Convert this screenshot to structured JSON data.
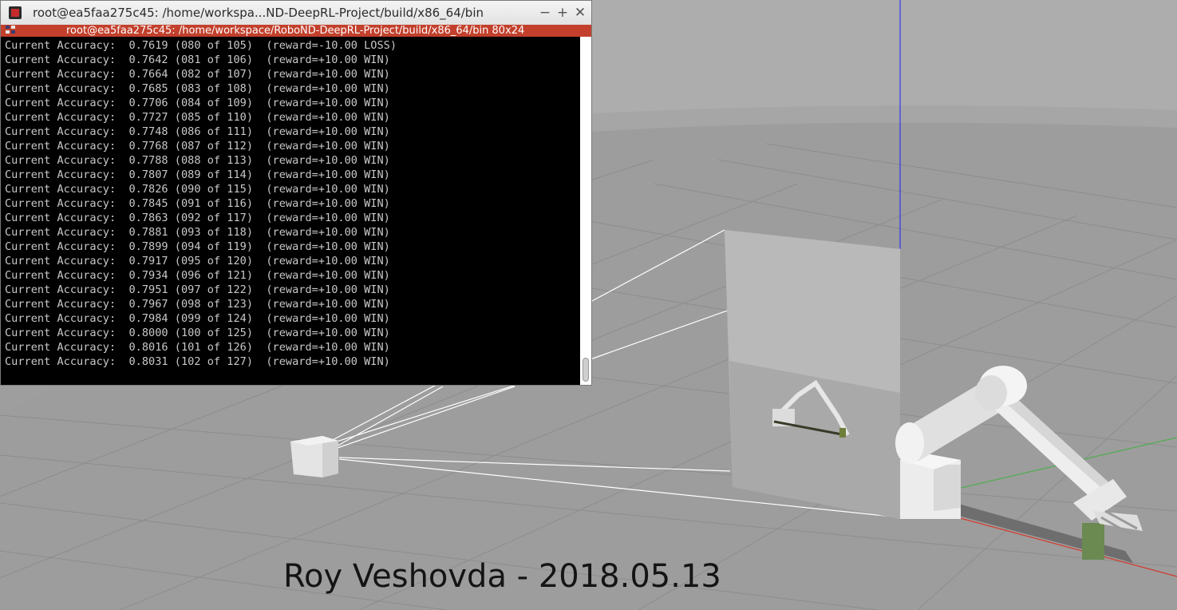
{
  "terminal": {
    "title": "root@ea5faa275c45: /home/workspa...ND-DeepRL-Project/build/x86_64/bin",
    "tab_label": "root@ea5faa275c45: /home/workspace/RoboND-DeepRL-Project/build/x86_64/bin 80x24",
    "minimize_glyph": "−",
    "maximize_glyph": "+",
    "close_glyph": "✕",
    "lines": [
      "Current Accuracy:  0.7619 (080 of 105)  (reward=-10.00 LOSS)",
      "Current Accuracy:  0.7642 (081 of 106)  (reward=+10.00 WIN)",
      "Current Accuracy:  0.7664 (082 of 107)  (reward=+10.00 WIN)",
      "Current Accuracy:  0.7685 (083 of 108)  (reward=+10.00 WIN)",
      "Current Accuracy:  0.7706 (084 of 109)  (reward=+10.00 WIN)",
      "Current Accuracy:  0.7727 (085 of 110)  (reward=+10.00 WIN)",
      "Current Accuracy:  0.7748 (086 of 111)  (reward=+10.00 WIN)",
      "Current Accuracy:  0.7768 (087 of 112)  (reward=+10.00 WIN)",
      "Current Accuracy:  0.7788 (088 of 113)  (reward=+10.00 WIN)",
      "Current Accuracy:  0.7807 (089 of 114)  (reward=+10.00 WIN)",
      "Current Accuracy:  0.7826 (090 of 115)  (reward=+10.00 WIN)",
      "Current Accuracy:  0.7845 (091 of 116)  (reward=+10.00 WIN)",
      "Current Accuracy:  0.7863 (092 of 117)  (reward=+10.00 WIN)",
      "Current Accuracy:  0.7881 (093 of 118)  (reward=+10.00 WIN)",
      "Current Accuracy:  0.7899 (094 of 119)  (reward=+10.00 WIN)",
      "Current Accuracy:  0.7917 (095 of 120)  (reward=+10.00 WIN)",
      "Current Accuracy:  0.7934 (096 of 121)  (reward=+10.00 WIN)",
      "Current Accuracy:  0.7951 (097 of 122)  (reward=+10.00 WIN)",
      "Current Accuracy:  0.7967 (098 of 123)  (reward=+10.00 WIN)",
      "Current Accuracy:  0.7984 (099 of 124)  (reward=+10.00 WIN)",
      "Current Accuracy:  0.8000 (100 of 125)  (reward=+10.00 WIN)",
      "Current Accuracy:  0.8016 (101 of 126)  (reward=+10.00 WIN)",
      "Current Accuracy:  0.8031 (102 of 127)  (reward=+10.00 WIN)"
    ]
  },
  "caption": "Roy Veshovda - 2018.05.13",
  "colors": {
    "tab_bar": "#c2402c",
    "terminal_bg": "#000000",
    "terminal_text": "#c8c8c8",
    "ground": "#9e9e9e",
    "sky": "#adadad",
    "z_axis": "#2020ff",
    "x_axis": "#d23a2a",
    "y_axis": "#40b040",
    "target_tube": "#6a8a52"
  }
}
